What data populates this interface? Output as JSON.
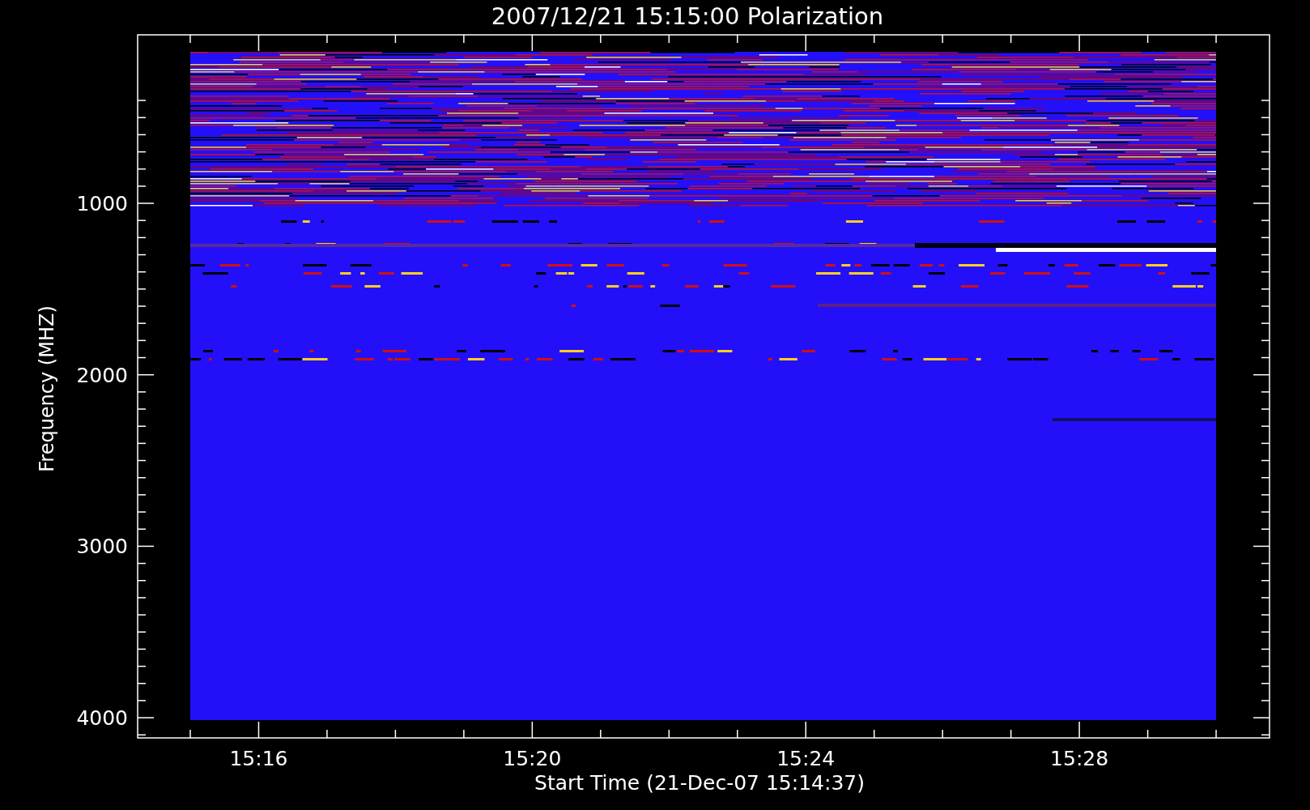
{
  "title": "2007/12/21 15:15:00 Polarization",
  "y_axis": {
    "label": "Frequency (MHZ)",
    "tick_labels": [
      "1000",
      "2000",
      "3000",
      "4000"
    ]
  },
  "x_axis": {
    "label": "Start Time (21-Dec-07 15:14:37)",
    "tick_labels": [
      "15:16",
      "15:20",
      "15:24",
      "15:28"
    ]
  }
}
